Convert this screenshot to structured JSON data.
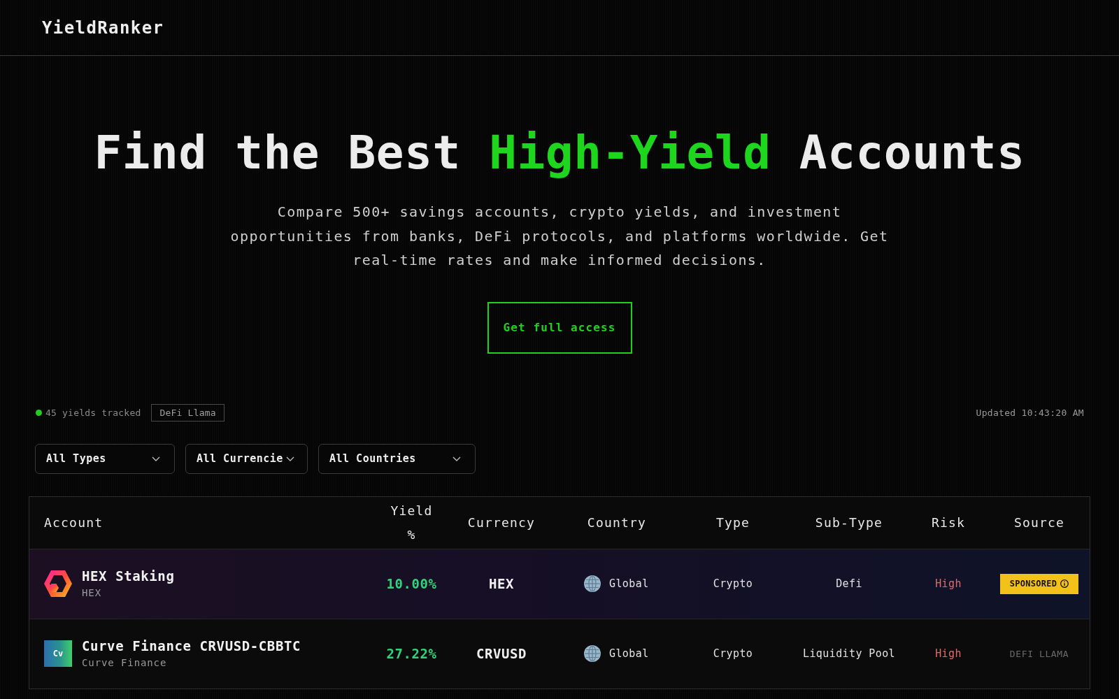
{
  "header": {
    "logo": "YieldRanker"
  },
  "hero": {
    "title_parts": [
      {
        "text": "Find the Best ",
        "highlight": false
      },
      {
        "text": "High-Yield",
        "highlight": true
      },
      {
        "text": " Accounts",
        "highlight": false
      }
    ],
    "subtitle": "Compare 500+ savings accounts, crypto yields, and investment opportunities from banks, DeFi protocols, and platforms worldwide. Get real-time rates and make informed decisions.",
    "cta": "Get full access"
  },
  "status": {
    "live": true,
    "tracked": "45 yields tracked",
    "source_tag": "DeFi Llama",
    "updated": "Updated 10:43:20 AM"
  },
  "filters": [
    {
      "label": "All Types"
    },
    {
      "label": "All Currencie"
    },
    {
      "label": "All Countries"
    }
  ],
  "table": {
    "columns": [
      "Account",
      "Yield %",
      "Currency",
      "Country",
      "Type",
      "Sub-Type",
      "Risk",
      "Source"
    ],
    "rows": [
      {
        "logo": {
          "kind": "hexagon"
        },
        "name": "HEX Staking",
        "provider": "HEX",
        "yield": "10.00%",
        "currency": "HEX",
        "country": "Global",
        "type": "Crypto",
        "sub_type": "Defi",
        "risk": {
          "label": "High",
          "color": "#e46a6a"
        },
        "source": "SPONSORED",
        "sponsored": true
      },
      {
        "logo": {
          "kind": "tile",
          "text": "Cv"
        },
        "name": "Curve Finance CRVUSD-CBBTC",
        "provider": "Curve Finance",
        "yield": "27.22%",
        "currency": "CRVUSD",
        "country": "Global",
        "type": "Crypto",
        "sub_type": "Liquidity Pool",
        "risk": {
          "label": "High",
          "color": "#e46a6a"
        },
        "source": "DEFI LLAMA",
        "sponsored": false
      }
    ]
  }
}
